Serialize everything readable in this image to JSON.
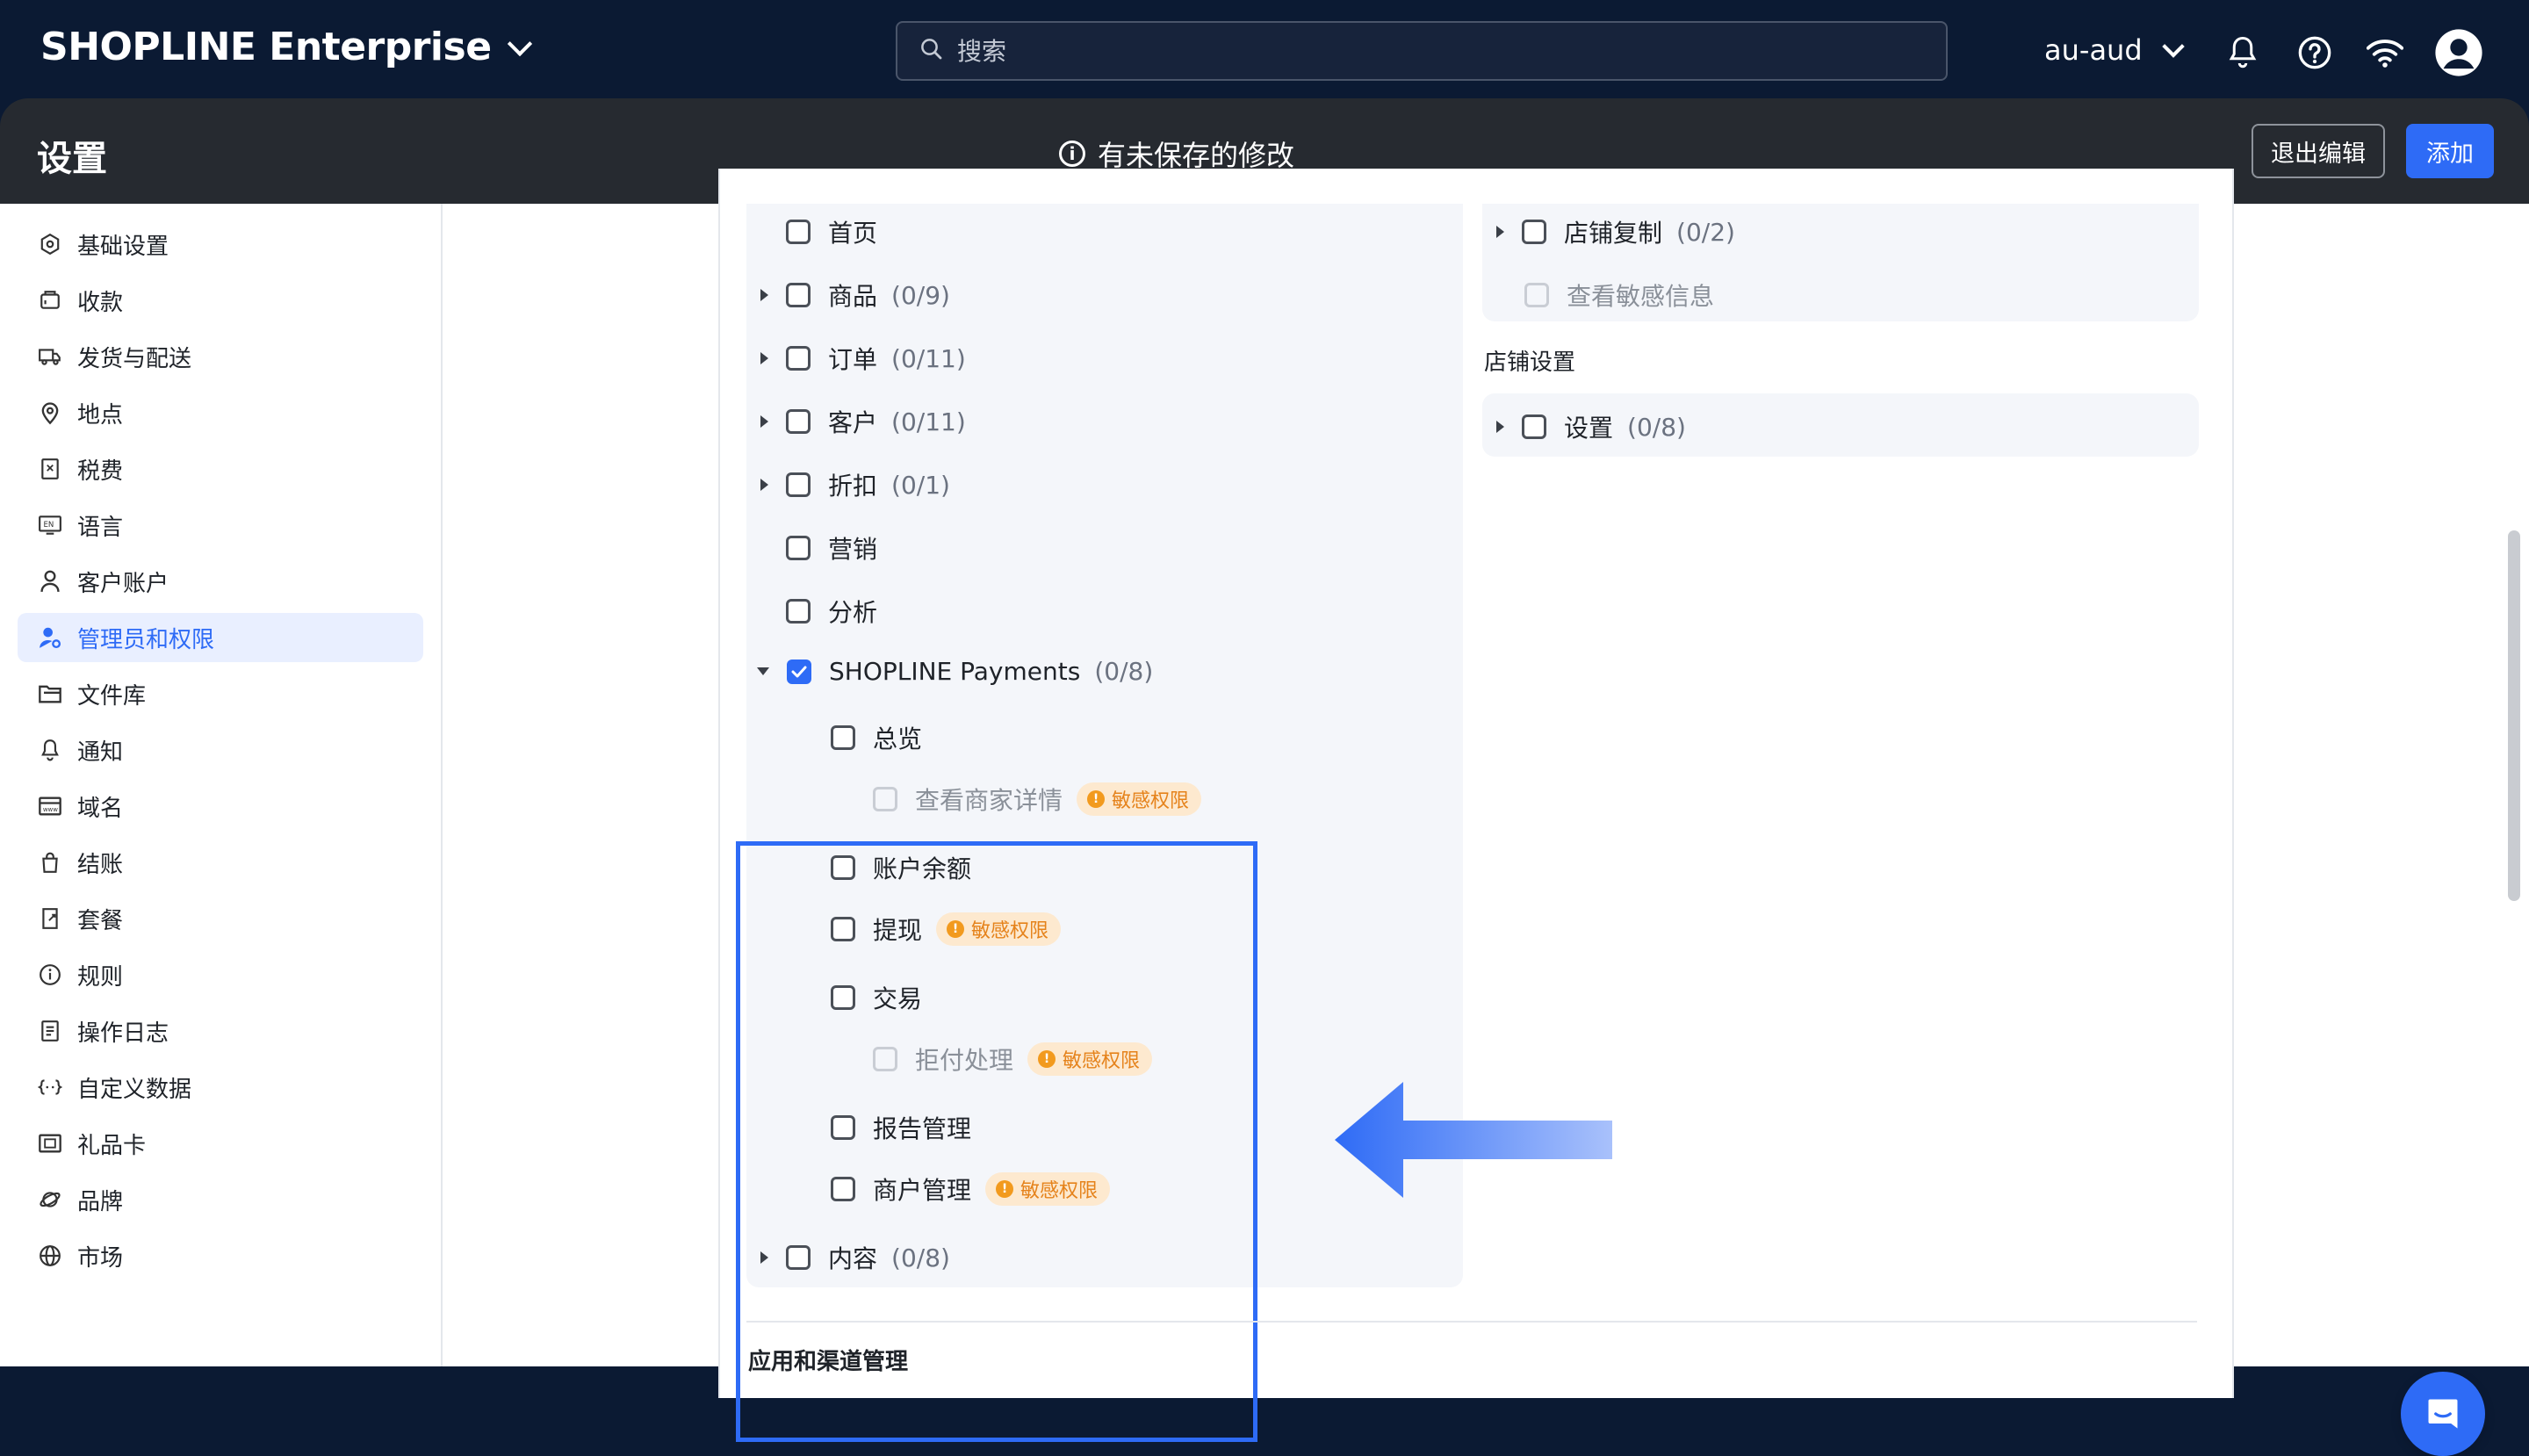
{
  "topbar": {
    "brand": "SHOPLINE Enterprise",
    "search_placeholder": "搜索",
    "store": "au-aud"
  },
  "header": {
    "title": "设置",
    "unsaved": "有未保存的修改",
    "exit_label": "退出编辑",
    "add_label": "添加"
  },
  "sidebar": {
    "items": [
      {
        "label": "基础设置",
        "icon": "settings-icon"
      },
      {
        "label": "收款",
        "icon": "payment-icon"
      },
      {
        "label": "发货与配送",
        "icon": "truck-icon"
      },
      {
        "label": "地点",
        "icon": "location-icon"
      },
      {
        "label": "税费",
        "icon": "tax-icon"
      },
      {
        "label": "语言",
        "icon": "language-icon"
      },
      {
        "label": "客户账户",
        "icon": "user-icon"
      },
      {
        "label": "管理员和权限",
        "icon": "admin-icon",
        "active": true
      },
      {
        "label": "文件库",
        "icon": "folder-icon"
      },
      {
        "label": "通知",
        "icon": "bell-icon"
      },
      {
        "label": "域名",
        "icon": "domain-icon"
      },
      {
        "label": "结账",
        "icon": "bag-icon"
      },
      {
        "label": "套餐",
        "icon": "plan-icon"
      },
      {
        "label": "规则",
        "icon": "info-icon"
      },
      {
        "label": "操作日志",
        "icon": "log-icon"
      },
      {
        "label": "自定义数据",
        "icon": "code-icon"
      },
      {
        "label": "礼品卡",
        "icon": "gift-card-icon"
      },
      {
        "label": "品牌",
        "icon": "brand-icon"
      },
      {
        "label": "市场",
        "icon": "globe-icon"
      }
    ]
  },
  "permissions_left": [
    {
      "label": "首页",
      "count": "",
      "expand": "none",
      "checked": false
    },
    {
      "label": "商品",
      "count": "(0/9)",
      "expand": "right",
      "checked": false
    },
    {
      "label": "订单",
      "count": "(0/11)",
      "expand": "right",
      "checked": false
    },
    {
      "label": "客户",
      "count": "(0/11)",
      "expand": "right",
      "checked": false
    },
    {
      "label": "折扣",
      "count": "(0/1)",
      "expand": "right",
      "checked": false
    },
    {
      "label": "营销",
      "count": "",
      "expand": "none",
      "checked": false
    },
    {
      "label": "分析",
      "count": "",
      "expand": "none",
      "checked": false
    },
    {
      "label": "SHOPLINE Payments",
      "count": "(0/8)",
      "expand": "down",
      "checked": true
    },
    {
      "label": "内容",
      "count": "(0/8)",
      "expand": "right",
      "checked": false
    }
  ],
  "payments_children": [
    {
      "label": "总览",
      "level": 1,
      "disabled": false,
      "sensitive": false
    },
    {
      "label": "查看商家详情",
      "level": 2,
      "disabled": true,
      "sensitive": true
    },
    {
      "label": "账户余额",
      "level": 1,
      "disabled": false,
      "sensitive": false
    },
    {
      "label": "提现",
      "level": 1,
      "disabled": false,
      "sensitive": true
    },
    {
      "label": "交易",
      "level": 1,
      "disabled": false,
      "sensitive": false
    },
    {
      "label": "拒付处理",
      "level": 2,
      "disabled": true,
      "sensitive": true
    },
    {
      "label": "报告管理",
      "level": 1,
      "disabled": false,
      "sensitive": false
    },
    {
      "label": "商户管理",
      "level": 1,
      "disabled": false,
      "sensitive": true
    }
  ],
  "sensitive_label": "敏感权限",
  "permissions_right": {
    "store_copy": {
      "label": "店铺复制",
      "count": "(0/2)"
    },
    "view_sensitive": {
      "label": "查看敏感信息"
    },
    "store_settings_title": "店铺设置",
    "settings": {
      "label": "设置",
      "count": "(0/8)"
    }
  },
  "bottom_section_title": "应用和渠道管理",
  "colors": {
    "accent": "#2e6bf6",
    "topbar": "#0b1a33",
    "header": "#262a30",
    "badge_bg": "#fde9cf",
    "badge_text": "#e5821a"
  }
}
